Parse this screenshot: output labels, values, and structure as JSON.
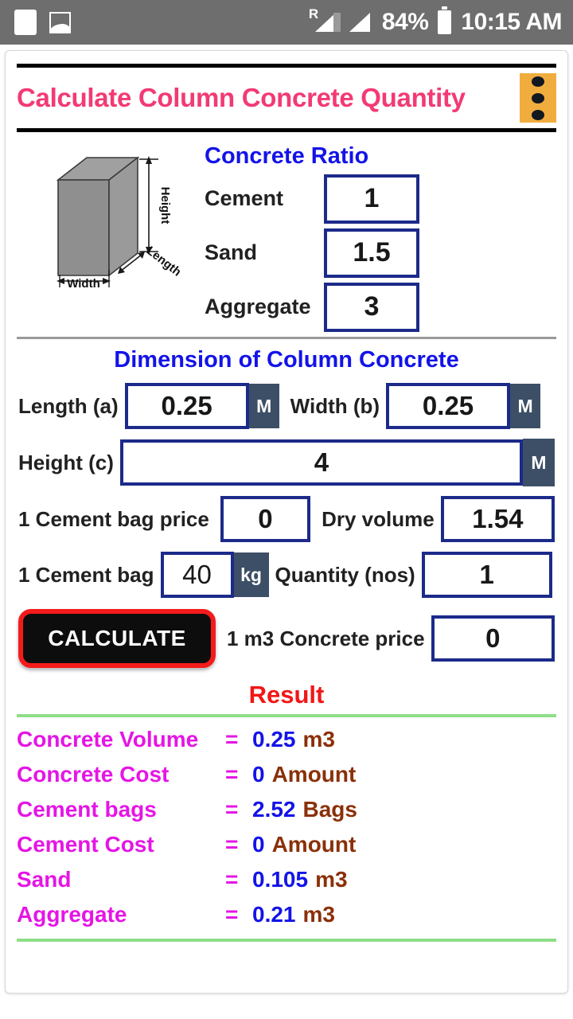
{
  "statusbar": {
    "battery_percent": "84%",
    "time": "10:15 AM",
    "roaming_mark": "R",
    "icons": [
      "blank-app-icon",
      "gallery-icon",
      "signal-roaming-icon",
      "signal-icon",
      "battery-icon"
    ]
  },
  "header": {
    "title": "Calculate Column Concrete Quantity",
    "menu_label": "overflow-menu"
  },
  "diagram": {
    "height_label": "Height",
    "length_label": "Length",
    "width_label": "Width"
  },
  "ratio": {
    "section_title": "Concrete Ratio",
    "rows": [
      {
        "label": "Cement",
        "value": "1"
      },
      {
        "label": "Sand",
        "value": "1.5"
      },
      {
        "label": "Aggregate",
        "value": "3"
      }
    ]
  },
  "dimension": {
    "section_title": "Dimension of Column Concrete",
    "length_label": "Length (a)",
    "length_value": "0.25",
    "length_unit": "M",
    "width_label": "Width (b)",
    "width_value": "0.25",
    "width_unit": "M",
    "height_label": "Height (c)",
    "height_value": "4",
    "height_unit": "M"
  },
  "inputs": {
    "bag_price_label": "1 Cement bag price",
    "bag_price_value": "0",
    "dry_volume_label": "Dry volume",
    "dry_volume_value": "1.54",
    "bag_weight_label": "1 Cement bag",
    "bag_weight_value": "40",
    "bag_weight_unit": "kg",
    "quantity_label": "Quantity (nos)",
    "quantity_value": "1",
    "concrete_price_label": "1 m3 Concrete price",
    "concrete_price_value": "0"
  },
  "actions": {
    "calculate_label": "CALCULATE"
  },
  "result": {
    "title": "Result",
    "rows": [
      {
        "label": "Concrete Volume",
        "eq": "=",
        "value": "0.25",
        "unit": "m3"
      },
      {
        "label": "Concrete Cost",
        "eq": "=",
        "value": "0",
        "unit": "Amount"
      },
      {
        "label": "Cement bags",
        "eq": "=",
        "value": "2.52",
        "unit": "Bags"
      },
      {
        "label": "Cement Cost",
        "eq": "=",
        "value": "0",
        "unit": "Amount"
      },
      {
        "label": "Sand",
        "eq": "=",
        "value": "0.105",
        "unit": "m3"
      },
      {
        "label": "Aggregate",
        "eq": "=",
        "value": "0.21",
        "unit": "m3"
      }
    ]
  },
  "colors": {
    "title_pink": "#f23a74",
    "section_blue": "#1313e8",
    "box_border": "#1c2a8a",
    "unit_badge": "#3d4f66",
    "menu_amber": "#f0ad3e",
    "result_red": "#f21616",
    "result_label_magenta": "#e515e5",
    "result_value_blue": "#1313e8",
    "result_unit_brown": "#8a3008",
    "divider_green": "#8ede88",
    "calc_button_bg": "#0d0d0d",
    "calc_button_border": "#f51b1b",
    "statusbar_grey": "#6e6e6e"
  }
}
